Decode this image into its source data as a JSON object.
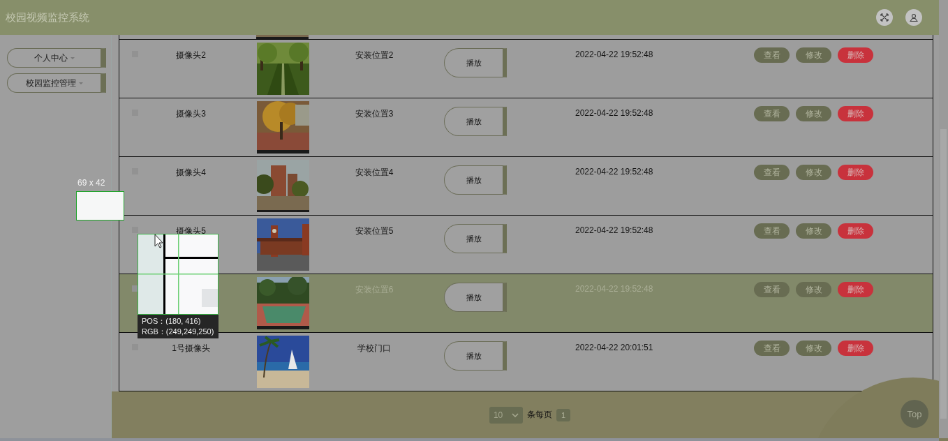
{
  "header": {
    "title": "校园视频监控系统"
  },
  "sidebar": {
    "items": [
      {
        "label": "个人中心"
      },
      {
        "label": "校园监控管理"
      }
    ]
  },
  "table": {
    "rows": [
      {
        "checked": false,
        "selected": false,
        "name": "摄像头2",
        "location": "安装位置2",
        "play": "播放",
        "time": "2022-04-22 19:52:48",
        "actions": [
          {
            "label": "查看",
            "kind": "default"
          },
          {
            "label": "修改",
            "kind": "default"
          },
          {
            "label": "删除",
            "kind": "danger"
          }
        ]
      },
      {
        "checked": false,
        "selected": false,
        "name": "摄像头3",
        "location": "安装位置3",
        "play": "播放",
        "time": "2022-04-22 19:52:48",
        "actions": [
          {
            "label": "查看",
            "kind": "default"
          },
          {
            "label": "修改",
            "kind": "default"
          },
          {
            "label": "删除",
            "kind": "danger"
          }
        ]
      },
      {
        "checked": false,
        "selected": false,
        "name": "摄像头4",
        "location": "安装位置4",
        "play": "播放",
        "time": "2022-04-22 19:52:48",
        "actions": [
          {
            "label": "查看",
            "kind": "default"
          },
          {
            "label": "修改",
            "kind": "default"
          },
          {
            "label": "删除",
            "kind": "danger"
          }
        ]
      },
      {
        "checked": false,
        "selected": false,
        "name": "摄像头5",
        "location": "安装位置5",
        "play": "播放",
        "time": "2022-04-22 19:52:48",
        "actions": [
          {
            "label": "查看",
            "kind": "default"
          },
          {
            "label": "修改",
            "kind": "default"
          },
          {
            "label": "删除",
            "kind": "danger"
          }
        ]
      },
      {
        "checked": false,
        "selected": true,
        "location": "安装位置6",
        "play": "播放",
        "time": "2022-04-22 19:52:48",
        "actions": [
          {
            "label": "查看",
            "kind": "default"
          },
          {
            "label": "修改",
            "kind": "default"
          },
          {
            "label": "删除",
            "kind": "danger"
          }
        ]
      },
      {
        "checked": false,
        "selected": false,
        "name": "1号摄像头",
        "location": "学校门口",
        "play": "播放",
        "time": "2022-04-22 20:01:51",
        "actions": [
          {
            "label": "查看",
            "kind": "default"
          },
          {
            "label": "修改",
            "kind": "default"
          },
          {
            "label": "删除",
            "kind": "danger"
          }
        ]
      }
    ]
  },
  "pagination": {
    "page_size": "10",
    "per_page_label": "条每页",
    "pages": [
      {
        "label": "1",
        "selected": true
      }
    ]
  },
  "back_to_top": "Top",
  "capture_overlay": {
    "size_label": "69 x 42",
    "info": [
      "POS：(180, 416)",
      "RGB：(249,249,250)"
    ]
  }
}
